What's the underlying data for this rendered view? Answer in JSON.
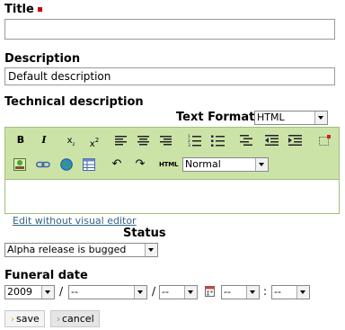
{
  "title": {
    "label": "Title",
    "value": ""
  },
  "description": {
    "label": "Description",
    "value": "Default description"
  },
  "technical": {
    "label": "Technical description",
    "text_format_label": "Text Format",
    "text_format_value": "HTML",
    "format_select": "Normal",
    "html_button": "HTML",
    "edit_link": "Edit without visual editor"
  },
  "status": {
    "label": "Status",
    "value": "Alpha release is bugged"
  },
  "funeral": {
    "label": "Funeral date",
    "year": "2009",
    "month": "--",
    "day": "--",
    "hour": "--",
    "minute": "--",
    "sep1": "/",
    "sep2": "/",
    "sep3": ":"
  },
  "buttons": {
    "save": "save",
    "cancel": "cancel"
  }
}
